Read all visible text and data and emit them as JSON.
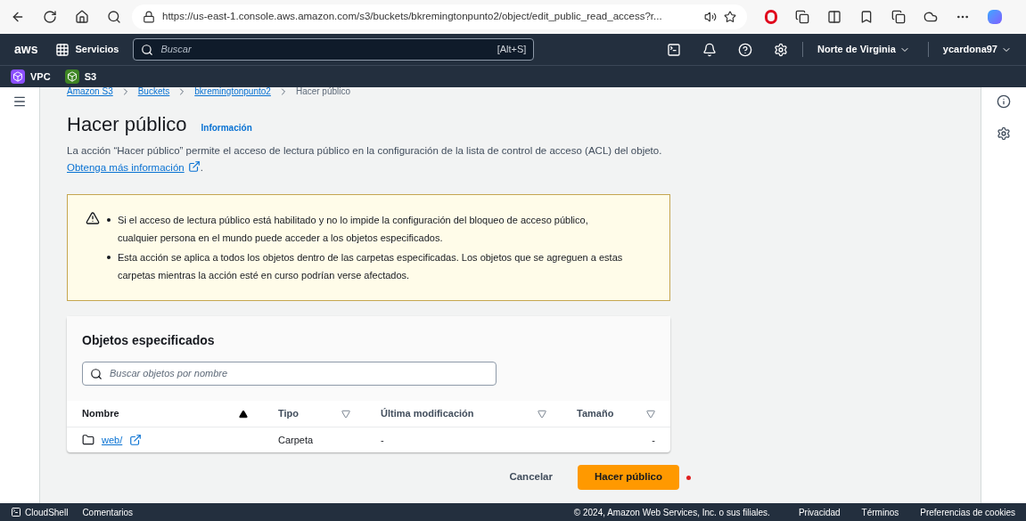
{
  "browser": {
    "url": "https://us-east-1.console.aws.amazon.com/s3/buckets/bkremingtonpunto2/object/edit_public_read_access?r..."
  },
  "top_nav": {
    "logo": "aws",
    "services": "Servicios",
    "search_placeholder": "Buscar",
    "shortcut": "[Alt+S]",
    "region": "Norte de Virginia",
    "user": "ycardona97"
  },
  "favorites": [
    {
      "label": "VPC",
      "color": "#8c4fff"
    },
    {
      "label": "S3",
      "color": "#3f8624"
    }
  ],
  "breadcrumbs": [
    {
      "label": "Amazon S3",
      "current": false
    },
    {
      "label": "Buckets",
      "current": false
    },
    {
      "label": "bkremingtonpunto2",
      "current": false
    },
    {
      "label": "Hacer público",
      "current": true
    }
  ],
  "page": {
    "title": "Hacer público",
    "info": "Información",
    "description": "La acción “Hacer público” permite el acceso de lectura público en la configuración de la lista de control de acceso (ACL) del objeto.",
    "learn_more": "Obtenga más información",
    "after_link": "."
  },
  "warning": {
    "items": [
      "Si el acceso de lectura público está habilitado y no lo impide la configuración del bloqueo de acceso público, cualquier persona en el mundo puede acceder a los objetos especificados.",
      "Esta acción se aplica a todos los objetos dentro de las carpetas especificadas. Los objetos que se agreguen a estas carpetas mientras la acción esté en curso podrían verse afectados."
    ]
  },
  "objects": {
    "title": "Objetos especificados",
    "search_placeholder": "Buscar objetos por nombre",
    "columns": [
      {
        "label": "Nombre",
        "sorted": true
      },
      {
        "label": "Tipo",
        "sorted": false
      },
      {
        "label": "Última modificación",
        "sorted": false
      },
      {
        "label": "Tamaño",
        "sorted": false
      }
    ],
    "rows": [
      {
        "name": "web/",
        "type": "Carpeta",
        "modified": "-",
        "size": "-"
      }
    ]
  },
  "actions": {
    "cancel": "Cancelar",
    "submit": "Hacer público"
  },
  "footer": {
    "cloudshell": "CloudShell",
    "feedback": "Comentarios",
    "copyright": "© 2024, Amazon Web Services, Inc. o sus filiales.",
    "links": [
      "Privacidad",
      "Términos",
      "Preferencias de cookies"
    ]
  }
}
